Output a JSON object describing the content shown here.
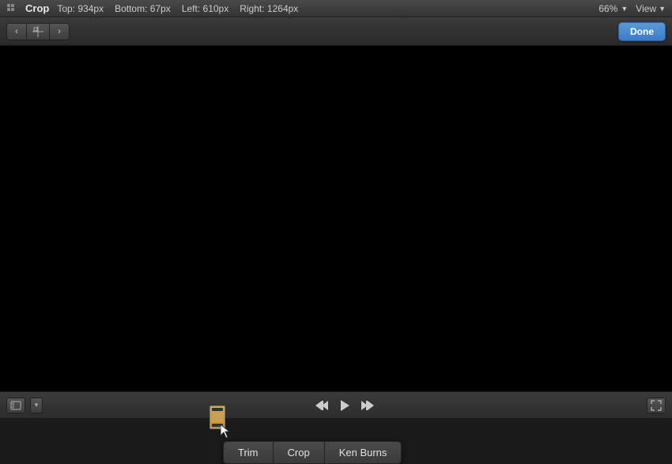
{
  "topbar": {
    "app_icon": "⊞",
    "title": "Crop",
    "top_label": "Top:",
    "top_value": "934px",
    "bottom_label": "Bottom:",
    "bottom_value": "67px",
    "left_label": "Left:",
    "left_value": "610px",
    "right_label": "Right:",
    "right_value": "1264px",
    "zoom": "66%",
    "dropdown_arrow": "▼",
    "view_label": "View",
    "view_arrow": "▼"
  },
  "toolbar": {
    "back_arrow": "‹",
    "center_icon": "✦",
    "forward_arrow": "›",
    "done_label": "Done"
  },
  "context_menu": {
    "items": [
      {
        "id": "trim",
        "label": "Trim"
      },
      {
        "id": "crop",
        "label": "Crop"
      },
      {
        "id": "ken-burns",
        "label": "Ken Burns"
      }
    ]
  },
  "bottom_bar": {
    "clip_icon": "▦",
    "down_arrow": "▾",
    "rewind_icon": "⏮",
    "play_icon": "▶",
    "fastforward_icon": "⏭",
    "expand_icon": "⤢"
  },
  "colors": {
    "accent_blue": "#4a8fd4",
    "done_bg": "#3a7bc8"
  }
}
